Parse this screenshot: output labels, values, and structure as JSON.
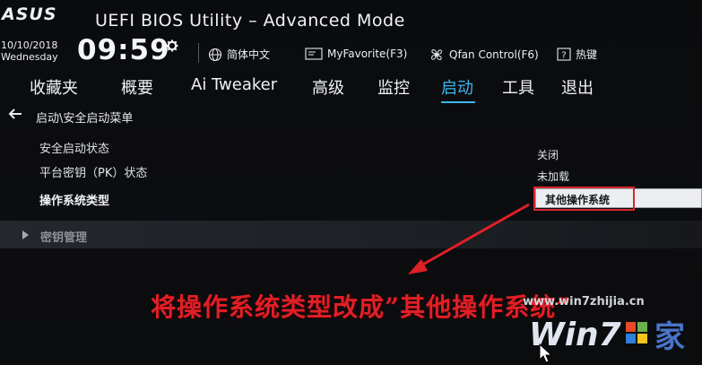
{
  "header": {
    "brand": "ASUS",
    "title": "UEFI BIOS Utility – Advanced Mode",
    "date": "10/10/2018",
    "day": "Wednesday",
    "time": "09:59"
  },
  "toolbar": {
    "language": "简体中文",
    "favorite": "MyFavorite(F3)",
    "qfan": "Qfan Control(F6)",
    "hotkeys": "热键"
  },
  "tabs": [
    {
      "label": "收藏夹",
      "active": false
    },
    {
      "label": "概要",
      "active": false
    },
    {
      "label": "Ai Tweaker",
      "active": false
    },
    {
      "label": "高级",
      "active": false
    },
    {
      "label": "监控",
      "active": false
    },
    {
      "label": "启动",
      "active": true
    },
    {
      "label": "工具",
      "active": false
    },
    {
      "label": "退出",
      "active": false
    }
  ],
  "breadcrumb": "启动\\安全启动菜单",
  "settings": [
    {
      "label": "安全启动状态",
      "value": "关闭"
    },
    {
      "label": "平台密钥（PK）状态",
      "value": "未加载"
    },
    {
      "label": "操作系统类型",
      "value": "其他操作系统"
    }
  ],
  "key_management": "密钥管理",
  "annotation": "将操作系统类型改成”其他操作系统”",
  "watermark": {
    "url": "www.win7zhijia.cn",
    "logo_text": "Win7",
    "logo_suffix": "家"
  },
  "colors": {
    "accent": "#3db7f0",
    "annotation": "#e01f26",
    "background": "#0b0c0e"
  }
}
